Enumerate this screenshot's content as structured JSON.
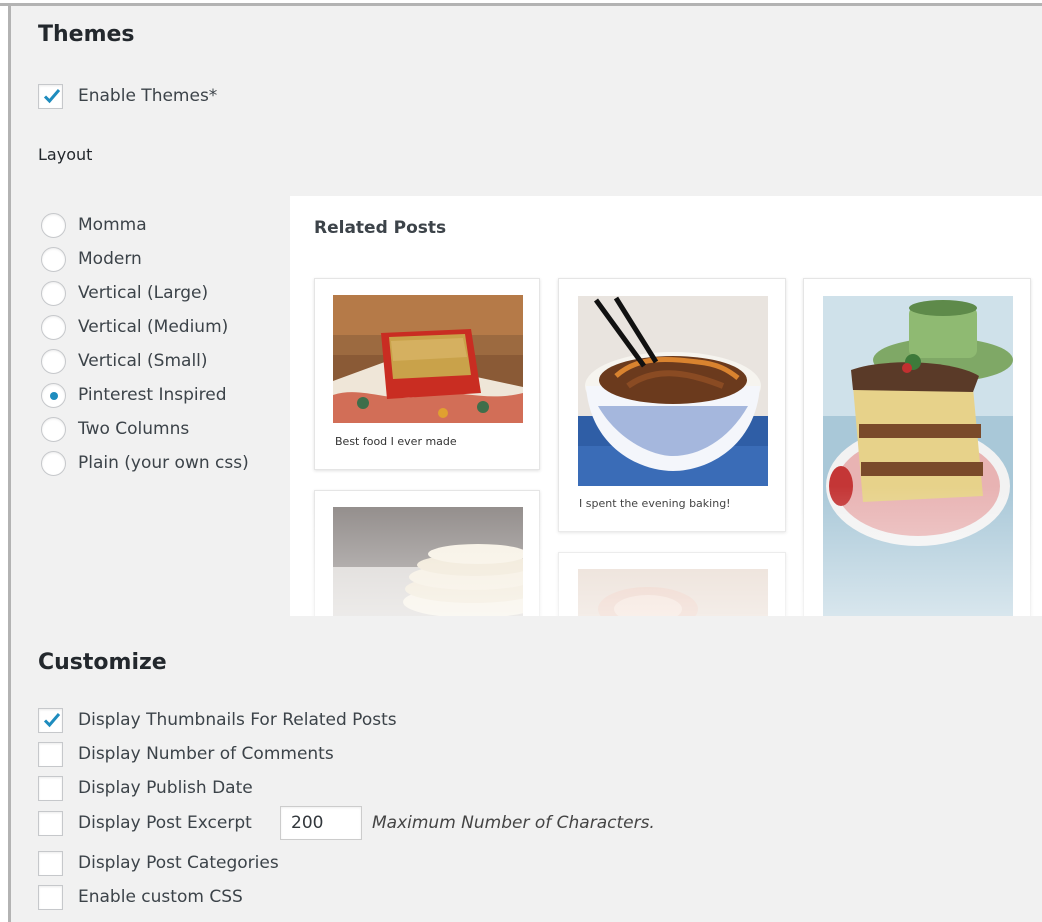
{
  "themes": {
    "heading": "Themes",
    "enable_label": "Enable Themes*",
    "enable_checked": true
  },
  "layout": {
    "heading": "Layout",
    "options": [
      "Momma",
      "Modern",
      "Vertical (Large)",
      "Vertical (Medium)",
      "Vertical (Small)",
      "Pinterest Inspired",
      "Two Columns",
      "Plain (your own css)"
    ],
    "selected": "Pinterest Inspired"
  },
  "preview": {
    "title": "Related Posts",
    "captions": [
      "Best food I ever made",
      "I spent the evening baking!"
    ]
  },
  "customize": {
    "heading": "Customize",
    "thumbnails_label": "Display Thumbnails For Related Posts",
    "thumbnails_checked": true,
    "comments_label": "Display Number of Comments",
    "publish_date_label": "Display Publish Date",
    "excerpt_label": "Display Post Excerpt",
    "excerpt_value": "200",
    "excerpt_hint": "Maximum Number of Characters.",
    "categories_label": "Display Post Categories",
    "custom_css_label": "Enable custom CSS"
  },
  "colors": {
    "accent": "#1e8cbe",
    "background": "#f1f1f1"
  }
}
